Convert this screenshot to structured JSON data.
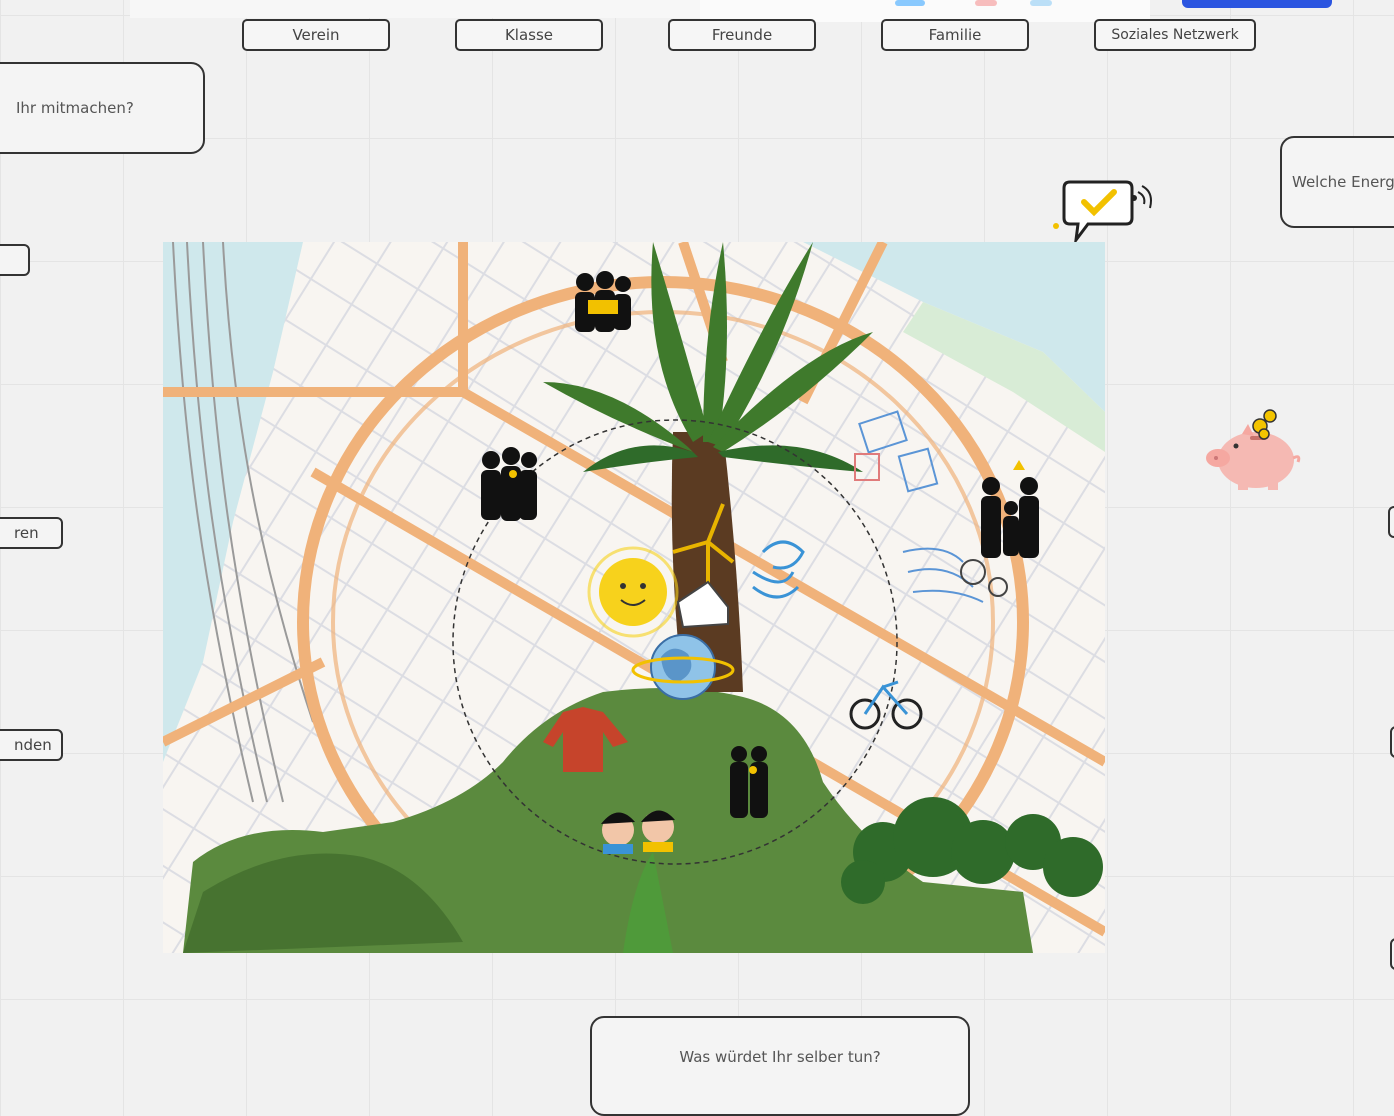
{
  "toolbar": {
    "accent_color": "#2b55e0"
  },
  "tags": [
    {
      "label": "Verein"
    },
    {
      "label": "Klasse"
    },
    {
      "label": "Freunde"
    },
    {
      "label": "Familie"
    },
    {
      "label": "Soziales Netzwerk"
    }
  ],
  "cards": {
    "top_left": "Ihr mitmachen?",
    "right": "Welche Energ",
    "bottom": "Was würdet Ihr selber tun?"
  },
  "stubs": {
    "left_mid": "ren",
    "left_low": "nden"
  },
  "canvas": {
    "background_color": "#f1f1f1",
    "grid_color": "#e4e4e4"
  },
  "artwork": {
    "road_color": "#f0b27a",
    "water_color": "#cde9ee",
    "hill_color": "#5b8a3e",
    "palm_color": "#3f7a2c",
    "sun_color": "#f7d21c"
  },
  "stickers": [
    "chat-check-sticker",
    "piggy-bank-sticker"
  ]
}
